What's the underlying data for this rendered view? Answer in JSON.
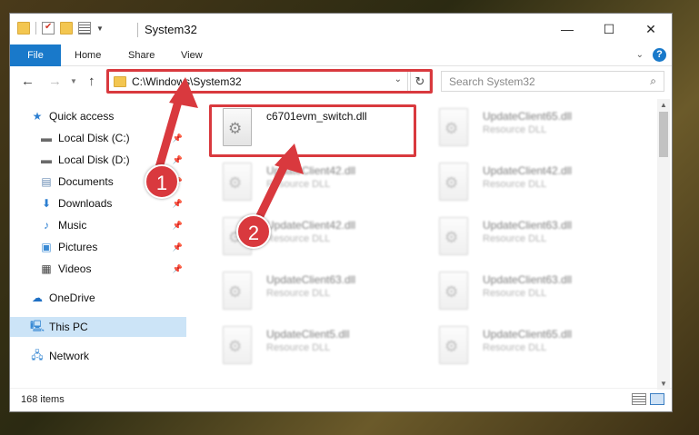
{
  "titlebar": {
    "title": "System32",
    "controls": {
      "minimize": "—",
      "maximize": "☐",
      "close": "✕"
    }
  },
  "ribbon": {
    "tabs": [
      "File",
      "Home",
      "Share",
      "View"
    ],
    "help": "?"
  },
  "address": {
    "path": "C:\\Windows\\System32",
    "search_placeholder": "Search System32"
  },
  "nav": {
    "items": [
      {
        "label": "Quick access",
        "icon": "star-icon"
      },
      {
        "label": "Local Disk (C:)",
        "icon": "drive-icon"
      },
      {
        "label": "Local Disk (D:)",
        "icon": "drive-icon"
      },
      {
        "label": "Documents",
        "icon": "documents-icon"
      },
      {
        "label": "Downloads",
        "icon": "download-icon"
      },
      {
        "label": "Music",
        "icon": "music-icon"
      },
      {
        "label": "Pictures",
        "icon": "pictures-icon"
      },
      {
        "label": "Videos",
        "icon": "videos-icon"
      },
      {
        "label": "OneDrive",
        "icon": "cloud-icon"
      },
      {
        "label": "This PC",
        "icon": "computer-icon"
      },
      {
        "label": "Network",
        "icon": "network-icon"
      }
    ]
  },
  "files": [
    {
      "name": "c6701evm_switch.dll",
      "type": ""
    },
    {
      "name": "UpdateClient65.dll",
      "type": "Resource DLL"
    },
    {
      "name": "UpdateClient42.dll",
      "type": "Resource DLL"
    },
    {
      "name": "UpdateClient42.dll",
      "type": "Resource DLL"
    },
    {
      "name": "UpdateClient42.dll",
      "type": "Resource DLL"
    },
    {
      "name": "UpdateClient63.dll",
      "type": "Resource DLL"
    },
    {
      "name": "UpdateClient63.dll",
      "type": "Resource DLL"
    },
    {
      "name": "UpdateClient63.dll",
      "type": "Resource DLL"
    },
    {
      "name": "UpdateClient5.dll",
      "type": "Resource DLL"
    },
    {
      "name": "UpdateClient65.dll",
      "type": "Resource DLL"
    }
  ],
  "status": {
    "count": "168 items"
  },
  "callouts": [
    "1",
    "2"
  ],
  "colors": {
    "accent": "#1979ca",
    "highlight": "#d9393e",
    "selection": "#cce4f7"
  }
}
